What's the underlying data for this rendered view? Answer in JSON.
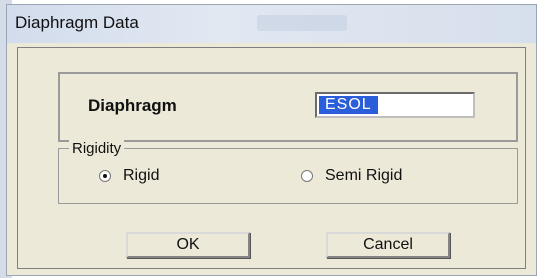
{
  "window": {
    "title": "Diaphragm Data"
  },
  "diaphragm": {
    "label": "Diaphragm",
    "value": "ESOL"
  },
  "rigidity": {
    "group_label": "Rigidity",
    "options": [
      {
        "label": "Rigid",
        "selected": true
      },
      {
        "label": "Semi Rigid",
        "selected": false
      }
    ]
  },
  "buttons": {
    "ok_label": "OK",
    "cancel_label": "Cancel"
  }
}
